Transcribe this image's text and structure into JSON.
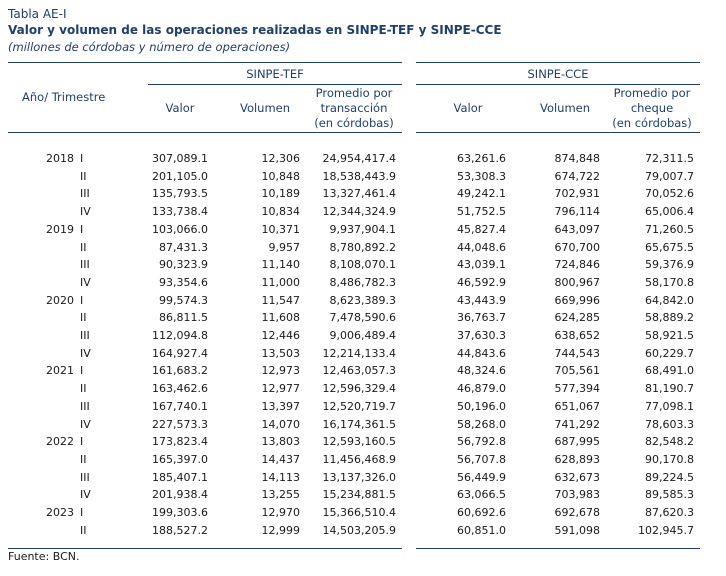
{
  "table_label": "Tabla AE-I",
  "title": "Valor y volumen de las operaciones realizadas en SINPE-TEF y SINPE-CCE",
  "subtitle": "(millones de córdobas y número de operaciones)",
  "row_header": "Año/ Trimestre",
  "groups": [
    {
      "name": "SINPE-TEF",
      "cols": [
        "Valor",
        "Volumen",
        "Promedio por\ntransacción\n(en córdobas)"
      ]
    },
    {
      "name": "SINPE-CCE",
      "cols": [
        "Valor",
        "Volumen",
        "Promedio por\ncheque\n(en córdobas)"
      ]
    }
  ],
  "rows": [
    {
      "year": "2018",
      "q": "I",
      "v": [
        "307,089.1",
        "12,306",
        "24,954,417.4",
        "63,261.6",
        "874,848",
        "72,311.5"
      ]
    },
    {
      "year": "",
      "q": "II",
      "v": [
        "201,105.0",
        "10,848",
        "18,538,443.9",
        "53,308.3",
        "674,722",
        "79,007.7"
      ]
    },
    {
      "year": "",
      "q": "III",
      "v": [
        "135,793.5",
        "10,189",
        "13,327,461.4",
        "49,242.1",
        "702,931",
        "70,052.6"
      ]
    },
    {
      "year": "",
      "q": "IV",
      "v": [
        "133,738.4",
        "10,834",
        "12,344,324.9",
        "51,752.5",
        "796,114",
        "65,006.4"
      ]
    },
    {
      "year": "2019",
      "q": "I",
      "v": [
        "103,066.0",
        "10,371",
        "9,937,904.1",
        "45,827.4",
        "643,097",
        "71,260.5"
      ]
    },
    {
      "year": "",
      "q": "II",
      "v": [
        "87,431.3",
        "9,957",
        "8,780,892.2",
        "44,048.6",
        "670,700",
        "65,675.5"
      ]
    },
    {
      "year": "",
      "q": "III",
      "v": [
        "90,323.9",
        "11,140",
        "8,108,070.1",
        "43,039.1",
        "724,846",
        "59,376.9"
      ]
    },
    {
      "year": "",
      "q": "IV",
      "v": [
        "93,354.6",
        "11,000",
        "8,486,782.3",
        "46,592.9",
        "800,967",
        "58,170.8"
      ]
    },
    {
      "year": "2020",
      "q": "I",
      "v": [
        "99,574.3",
        "11,547",
        "8,623,389.3",
        "43,443.9",
        "669,996",
        "64,842.0"
      ]
    },
    {
      "year": "",
      "q": "II",
      "v": [
        "86,811.5",
        "11,608",
        "7,478,590.6",
        "36,763.7",
        "624,285",
        "58,889.2"
      ]
    },
    {
      "year": "",
      "q": "III",
      "v": [
        "112,094.8",
        "12,446",
        "9,006,489.4",
        "37,630.3",
        "638,652",
        "58,921.5"
      ]
    },
    {
      "year": "",
      "q": "IV",
      "v": [
        "164,927.4",
        "13,503",
        "12,214,133.4",
        "44,843.6",
        "744,543",
        "60,229.7"
      ]
    },
    {
      "year": "2021",
      "q": "I",
      "v": [
        "161,683.2",
        "12,973",
        "12,463,057.3",
        "48,324.6",
        "705,561",
        "68,491.0"
      ]
    },
    {
      "year": "",
      "q": "II",
      "v": [
        "163,462.6",
        "12,977",
        "12,596,329.4",
        "46,879.0",
        "577,394",
        "81,190.7"
      ]
    },
    {
      "year": "",
      "q": "III",
      "v": [
        "167,740.1",
        "13,397",
        "12,520,719.7",
        "50,196.0",
        "651,067",
        "77,098.1"
      ]
    },
    {
      "year": "",
      "q": "IV",
      "v": [
        "227,573.3",
        "14,070",
        "16,174,361.5",
        "58,268.0",
        "741,292",
        "78,603.3"
      ]
    },
    {
      "year": "2022",
      "q": "I",
      "v": [
        "173,823.4",
        "13,803",
        "12,593,160.5",
        "56,792.8",
        "687,995",
        "82,548.2"
      ]
    },
    {
      "year": "",
      "q": "II",
      "v": [
        "165,397.0",
        "14,437",
        "11,456,468.9",
        "56,707.8",
        "628,893",
        "90,170.8"
      ]
    },
    {
      "year": "",
      "q": "III",
      "v": [
        "185,407.1",
        "14,113",
        "13,137,326.0",
        "56,449.9",
        "632,673",
        "89,224.5"
      ]
    },
    {
      "year": "",
      "q": "IV",
      "v": [
        "201,938.4",
        "13,255",
        "15,234,881.5",
        "63,066.5",
        "703,983",
        "89,585.3"
      ]
    },
    {
      "year": "2023",
      "q": "I",
      "v": [
        "199,303.6",
        "12,970",
        "15,366,510.4",
        "60,692.6",
        "692,678",
        "87,620.3"
      ]
    },
    {
      "year": "",
      "q": "II",
      "v": [
        "188,527.2",
        "12,999",
        "14,503,205.9",
        "60,851.0",
        "591,098",
        "102,945.7"
      ]
    }
  ],
  "footer": "Fuente: BCN."
}
